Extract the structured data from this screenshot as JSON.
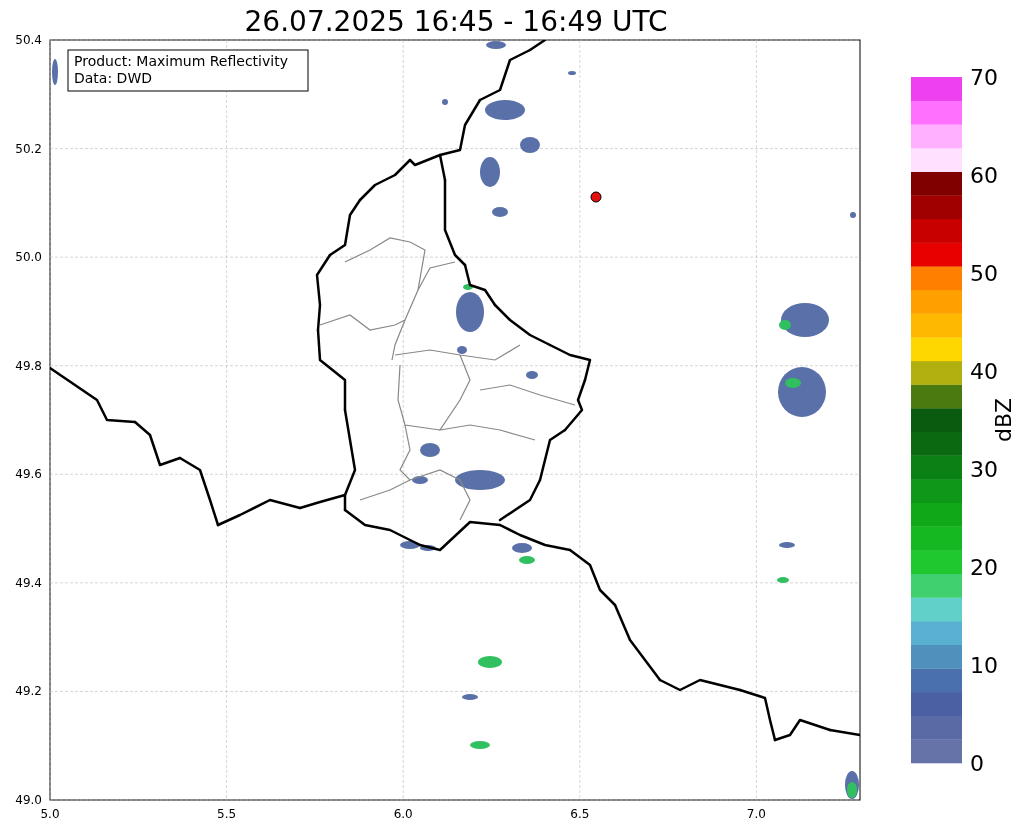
{
  "title": "26.07.2025 16:45 - 16:49 UTC",
  "info_box": [
    "Product: Maximum Reflectivity",
    "Data: DWD"
  ],
  "x_ticks": [
    "5.0",
    "5.5",
    "6.0",
    "6.5",
    "7.0"
  ],
  "y_ticks": [
    "50.4",
    "50.2",
    "50.0",
    "49.8",
    "49.6",
    "49.4",
    "49.2",
    "49.0"
  ],
  "colorbar": {
    "label": "dBZ",
    "ticks": [
      "70",
      "60",
      "50",
      "40",
      "30",
      "20",
      "10",
      "0"
    ],
    "segments": [
      {
        "color": "#6673a8"
      },
      {
        "color": "#5a6aa5"
      },
      {
        "color": "#4b5fa3"
      },
      {
        "color": "#4a70ad"
      },
      {
        "color": "#5090bd"
      },
      {
        "color": "#5ab0d0"
      },
      {
        "color": "#60d0c8"
      },
      {
        "color": "#40d070"
      },
      {
        "color": "#20c830"
      },
      {
        "color": "#15b820"
      },
      {
        "color": "#10a818"
      },
      {
        "color": "#0d9818"
      },
      {
        "color": "#0b8014"
      },
      {
        "color": "#0a6a12"
      },
      {
        "color": "#0a5a10"
      },
      {
        "color": "#4a7a10"
      },
      {
        "color": "#b0b010"
      },
      {
        "color": "#ffd700"
      },
      {
        "color": "#ffb800"
      },
      {
        "color": "#ffa000"
      },
      {
        "color": "#ff8000"
      },
      {
        "color": "#e80000"
      },
      {
        "color": "#c80000"
      },
      {
        "color": "#a00000"
      },
      {
        "color": "#800000"
      },
      {
        "color": "#ffe0ff"
      },
      {
        "color": "#ffb0ff"
      },
      {
        "color": "#ff70ff"
      },
      {
        "color": "#ee40ee"
      }
    ]
  }
}
